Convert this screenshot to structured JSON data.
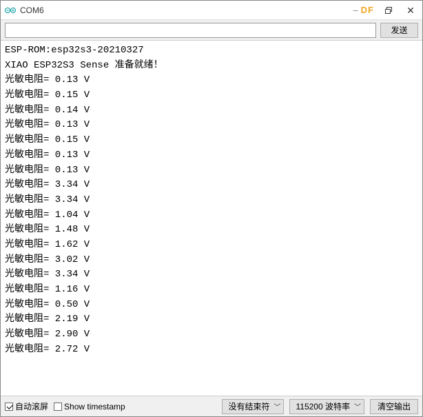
{
  "window": {
    "title": "COM6",
    "badge_prefix": "–",
    "badge": "DF"
  },
  "toolbar": {
    "send_label": "发送",
    "input_value": "",
    "input_placeholder": ""
  },
  "console": {
    "lines": [
      "ESP-ROM:esp32s3-20210327",
      "XIAO ESP32S3 Sense 准备就绪！",
      "光敏电阻= 0.13 V",
      "光敏电阻= 0.15 V",
      "光敏电阻= 0.14 V",
      "光敏电阻= 0.13 V",
      "光敏电阻= 0.15 V",
      "光敏电阻= 0.13 V",
      "光敏电阻= 0.13 V",
      "光敏电阻= 3.34 V",
      "光敏电阻= 3.34 V",
      "光敏电阻= 1.04 V",
      "光敏电阻= 1.48 V",
      "光敏电阻= 1.62 V",
      "光敏电阻= 3.02 V",
      "光敏电阻= 3.34 V",
      "光敏电阻= 1.16 V",
      "光敏电阻= 0.50 V",
      "光敏电阻= 2.19 V",
      "光敏电阻= 2.90 V",
      "光敏电阻= 2.72 V"
    ]
  },
  "status": {
    "autoscroll_label": "自动滚屏",
    "autoscroll_checked": true,
    "timestamp_label": "Show timestamp",
    "timestamp_checked": false,
    "line_ending": "没有结束符",
    "baud_rate": "115200 波特率",
    "clear_label": "清空输出"
  }
}
